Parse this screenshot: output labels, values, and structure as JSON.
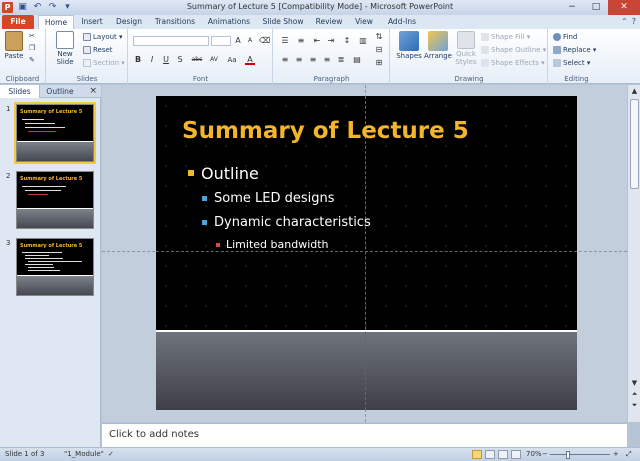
{
  "window": {
    "title": "Summary of Lecture 5 [Compatibility Mode] - Microsoft PowerPoint",
    "app_icon_letter": "P",
    "controls": {
      "minimize": "−",
      "maximize": "□",
      "close": "✕"
    }
  },
  "tabs": {
    "file": "File",
    "items": [
      "Home",
      "Insert",
      "Design",
      "Transitions",
      "Animations",
      "Slide Show",
      "Review",
      "View",
      "Add-Ins"
    ],
    "active": "Home"
  },
  "ribbon": {
    "clipboard": {
      "label": "Clipboard",
      "paste": "Paste"
    },
    "slides": {
      "label": "Slides",
      "new_slide": "New Slide",
      "layout": "Layout",
      "reset": "Reset",
      "section": "Section"
    },
    "font": {
      "label": "Font",
      "format_buttons": [
        "B",
        "I",
        "U",
        "S",
        "abc",
        "AV",
        "Aa",
        "A"
      ]
    },
    "paragraph": {
      "label": "Paragraph"
    },
    "drawing": {
      "label": "Drawing",
      "shapes": "Shapes",
      "arrange": "Arrange",
      "quick_styles": "Quick Styles",
      "shape_fill": "Shape Fill",
      "shape_outline": "Shape Outline",
      "shape_effects": "Shape Effects"
    },
    "editing": {
      "label": "Editing",
      "find": "Find",
      "replace": "Replace",
      "select": "Select"
    }
  },
  "left_panel": {
    "tabs": [
      "Slides",
      "Outline"
    ],
    "close": "×",
    "thumbnails": [
      {
        "num": "1",
        "title": "Summary of Lecture 5",
        "selected": true
      },
      {
        "num": "2",
        "title": "Summary of Lecture 5",
        "selected": false
      },
      {
        "num": "3",
        "title": "Summary of Lecture 5",
        "selected": false
      }
    ]
  },
  "slide": {
    "title": "Summary of Lecture 5",
    "bullets": [
      {
        "level": 1,
        "text": "Outline",
        "mark_color": "#f3b62b"
      },
      {
        "level": 2,
        "text": "Some LED designs",
        "mark_color": "#4fa3d9"
      },
      {
        "level": 2,
        "text": "Dynamic characteristics",
        "mark_color": "#4fa3d9"
      },
      {
        "level": 3,
        "text": "Limited bandwidth",
        "mark_color": "#d84a4a"
      }
    ]
  },
  "notes": {
    "placeholder": "Click to add notes"
  },
  "status": {
    "slide_of": "Slide 1 of 3",
    "theme": "\"1_Module\"",
    "zoom": "70%"
  },
  "colors": {
    "accent_file": "#d24726",
    "title_gold": "#f3b62b"
  }
}
